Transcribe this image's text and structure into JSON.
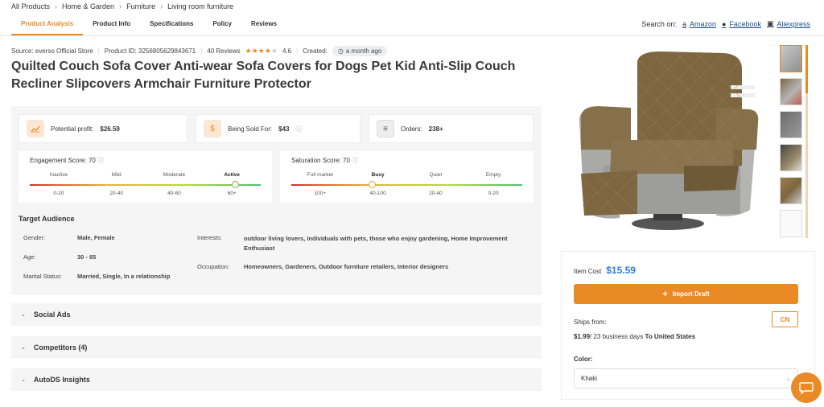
{
  "breadcrumb": [
    "All Products",
    "Home & Garden",
    "Furniture",
    "Living room furniture"
  ],
  "tabs": [
    "Product Analysis",
    "Product Info",
    "Specifications",
    "Policy",
    "Reviews"
  ],
  "search_on": {
    "label": "Search on:",
    "links": [
      "Amazon",
      "Facebook",
      "Aliexpress"
    ]
  },
  "meta": {
    "source": "Source: everso Official Store",
    "product_id": "Product ID: 3256805629843671",
    "reviews": "40 Reviews",
    "rating": "4.6",
    "created_label": "Created:",
    "created_value": "a month ago"
  },
  "title": "Quilted Couch Sofa Cover Anti-wear Sofa Covers for Dogs Pet Kid Anti-Slip Couch Recliner Slipcovers Armchair Furniture Protector",
  "cards": {
    "profit_label": "Potential profit:",
    "profit_value": "$26.59",
    "sold_label": "Being Sold For:",
    "sold_value": "$43",
    "orders_label": "Orders:",
    "orders_value": "238+"
  },
  "engagement": {
    "label": "Engagement Score:",
    "value": "70",
    "levels": [
      "Inactive",
      "Mild",
      "Moderate",
      "Active"
    ],
    "ranges": [
      "0-20",
      "20-40",
      "40-60",
      "60+"
    ],
    "active_index": 3,
    "position": 0.89
  },
  "saturation": {
    "label": "Saturation Score:",
    "value": "70",
    "levels": [
      "Full market",
      "Busy",
      "Quiet",
      "Empty"
    ],
    "ranges": [
      "100+",
      "40-100",
      "20-40",
      "0-20"
    ],
    "active_index": 1,
    "position": 0.35
  },
  "audience": {
    "title": "Target Audience",
    "gender_label": "Gender:",
    "gender": "Male, Female",
    "age_label": "Age:",
    "age": "30 - 65",
    "marital_label": "Marital Status:",
    "marital": "Married, Single, In a relationship",
    "interests_label": "Interests:",
    "interests": "outdoor living lovers, individuals with pets, those who enjoy gardening, Home Improvement Enthusiast",
    "occupation_label": "Occupation:",
    "occupation": "Homeowners, Gardeners, Outdoor furniture retailers, Interior designers"
  },
  "accordions": [
    "Social Ads",
    "Competitors (4)",
    "AutoDS Insights"
  ],
  "buybox": {
    "item_cost_label": "Item Cost",
    "item_cost": "$15.59",
    "import_label": "Import Draft",
    "ships_from_label": "Ships from:",
    "ships_from": "CN",
    "ship_price": "$1.99",
    "ship_days": "/ 23 business days",
    "ship_to": "To United States",
    "color_label": "Color:",
    "color_value": "Khaki"
  },
  "colors": {
    "accent": "#e98a26",
    "price": "#2f7bd6",
    "link": "#1e4e8c"
  }
}
